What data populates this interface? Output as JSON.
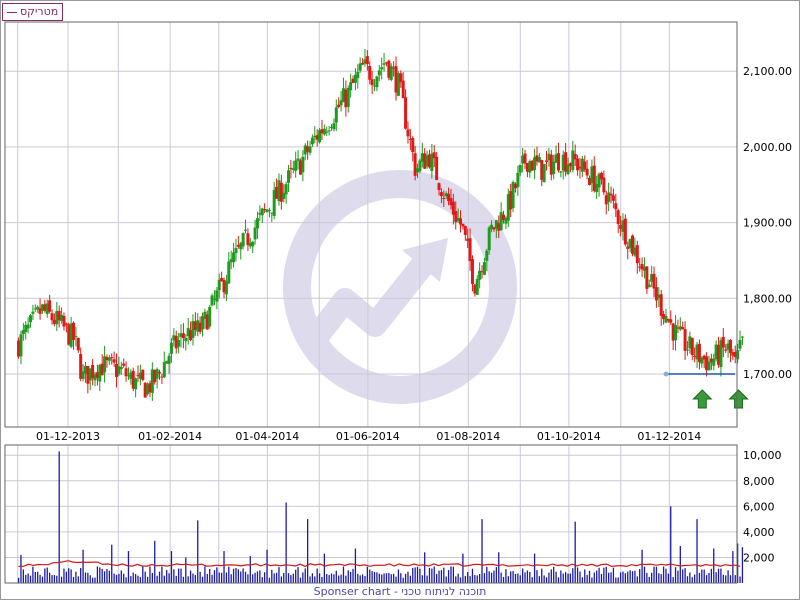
{
  "legend": {
    "label": "מטריקס"
  },
  "footer": {
    "text": "Sponser chart - תוכנה לניתוח טכני"
  },
  "colors": {
    "up": "#1f9a1f",
    "down": "#e01818",
    "volume": "#1a1aa8",
    "volume_ma": "#d01818",
    "support": "#1a5aa8",
    "grid": "#c9c9d8",
    "frame": "#666666",
    "arrow": "#3a9a3a",
    "watermark": "#dedcec"
  },
  "chart_data": [
    {
      "type": "candlestick",
      "name": "price",
      "title": "",
      "xlabel": "",
      "ylabel": "",
      "x_ticks": [
        "01-12-2013",
        "01-02-2014",
        "01-04-2014",
        "01-06-2014",
        "01-08-2014",
        "01-10-2014",
        "01-12-2014"
      ],
      "y_ticks": [
        "1,700.00",
        "1,800.00",
        "1,900.00",
        "2,000.00",
        "2,100.00"
      ],
      "ylim": [
        1630,
        2165
      ],
      "grid": true,
      "y_axis_side": "right",
      "approx_close_series": [
        [
          "2013-11-01",
          1740
        ],
        [
          "2013-11-15",
          1785
        ],
        [
          "2013-11-25",
          1768
        ],
        [
          "2013-12-05",
          1745
        ],
        [
          "2013-12-10",
          1695
        ],
        [
          "2013-12-20",
          1712
        ],
        [
          "2014-01-02",
          1705
        ],
        [
          "2014-01-10",
          1690
        ],
        [
          "2014-01-18",
          1682
        ],
        [
          "2014-01-25",
          1698
        ],
        [
          "2014-02-01",
          1730
        ],
        [
          "2014-02-10",
          1752
        ],
        [
          "2014-02-20",
          1760
        ],
        [
          "2014-03-01",
          1800
        ],
        [
          "2014-03-10",
          1845
        ],
        [
          "2014-03-20",
          1880
        ],
        [
          "2014-03-31",
          1915
        ],
        [
          "2014-04-10",
          1945
        ],
        [
          "2014-04-20",
          1975
        ],
        [
          "2014-05-01",
          2015
        ],
        [
          "2014-05-10",
          2040
        ],
        [
          "2014-05-20",
          2070
        ],
        [
          "2014-05-29",
          2105
        ],
        [
          "2014-06-05",
          2095
        ],
        [
          "2014-06-12",
          2115
        ],
        [
          "2014-06-20",
          2080
        ],
        [
          "2014-06-30",
          1970
        ],
        [
          "2014-07-08",
          1990
        ],
        [
          "2014-07-18",
          1935
        ],
        [
          "2014-07-28",
          1895
        ],
        [
          "2014-08-05",
          1820
        ],
        [
          "2014-08-15",
          1890
        ],
        [
          "2014-08-25",
          1920
        ],
        [
          "2014-09-05",
          1985
        ],
        [
          "2014-09-15",
          1970
        ],
        [
          "2014-09-25",
          1985
        ],
        [
          "2014-10-05",
          1980
        ],
        [
          "2014-10-15",
          1960
        ],
        [
          "2014-10-25",
          1935
        ],
        [
          "2014-11-05",
          1885
        ],
        [
          "2014-11-15",
          1840
        ],
        [
          "2014-11-25",
          1795
        ],
        [
          "2014-12-05",
          1752
        ],
        [
          "2014-12-15",
          1730
        ],
        [
          "2014-12-25",
          1715
        ],
        [
          "2015-01-05",
          1735
        ],
        [
          "2015-01-10",
          1712
        ],
        [
          "2015-01-15",
          1745
        ]
      ],
      "annotations": {
        "support_level": 1700,
        "up_arrow_dates": [
          "2014-12-21",
          "2015-01-12"
        ]
      }
    },
    {
      "type": "bar",
      "name": "volume",
      "title": "",
      "xlabel": "",
      "ylabel": "",
      "y_ticks": [
        "2,000",
        "4,000",
        "6,000",
        "8,000",
        "10,000"
      ],
      "ylim": [
        0,
        10800
      ],
      "grid": true,
      "y_axis_side": "right",
      "baseline_volume": 1000,
      "moving_average_level": 1400,
      "spikes": [
        [
          "2013-11-03",
          2200
        ],
        [
          "2013-11-25",
          10300
        ],
        [
          "2013-12-10",
          2600
        ],
        [
          "2013-12-28",
          3000
        ],
        [
          "2014-01-07",
          2500
        ],
        [
          "2014-01-22",
          3300
        ],
        [
          "2014-02-02",
          2500
        ],
        [
          "2014-02-10",
          2000
        ],
        [
          "2014-02-18",
          4900
        ],
        [
          "2014-03-05",
          2500
        ],
        [
          "2014-03-22",
          2100
        ],
        [
          "2014-04-01",
          2600
        ],
        [
          "2014-04-12",
          6300
        ],
        [
          "2014-04-25",
          5000
        ],
        [
          "2014-05-05",
          2300
        ],
        [
          "2014-05-25",
          2700
        ],
        [
          "2014-07-05",
          2400
        ],
        [
          "2014-07-28",
          2300
        ],
        [
          "2014-08-10",
          5000
        ],
        [
          "2014-08-20",
          2400
        ],
        [
          "2014-09-10",
          2300
        ],
        [
          "2014-10-05",
          4800
        ],
        [
          "2014-11-15",
          2600
        ],
        [
          "2014-12-02",
          6000
        ],
        [
          "2014-12-08",
          2900
        ],
        [
          "2014-12-18",
          5000
        ],
        [
          "2014-12-28",
          2700
        ],
        [
          "2015-01-08",
          2500
        ],
        [
          "2015-01-12",
          3100
        ],
        [
          "2015-01-15",
          2800
        ]
      ]
    }
  ]
}
